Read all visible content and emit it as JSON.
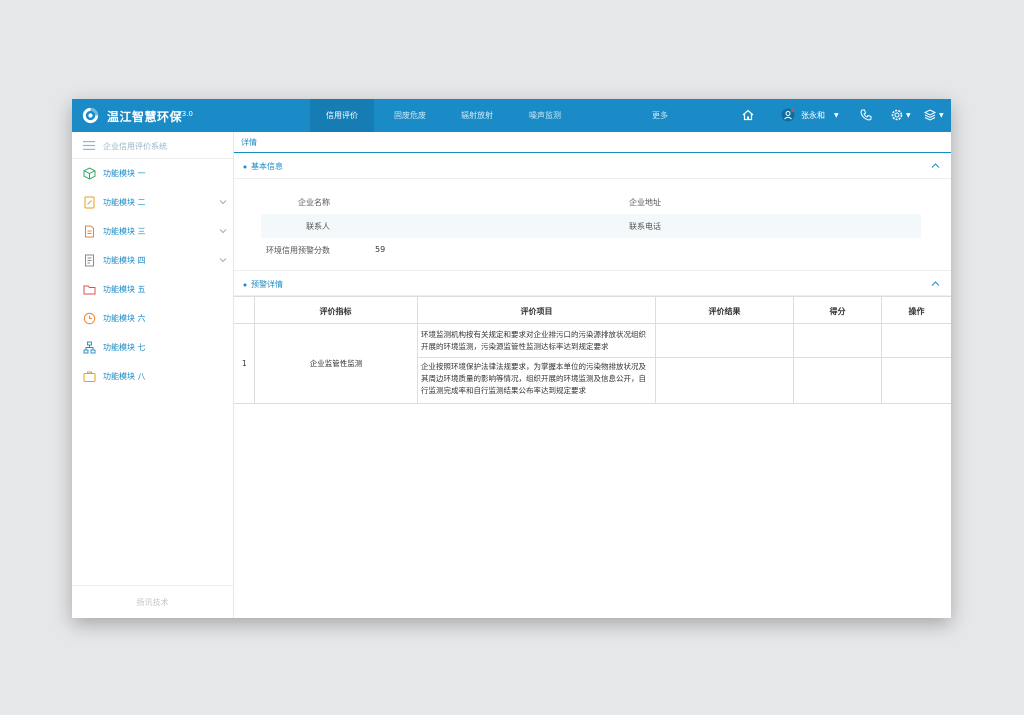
{
  "header": {
    "app_title": "温江智慧环保",
    "version": "V3.0",
    "nav_tabs": [
      {
        "label": "信用评价",
        "active": true
      },
      {
        "label": "固废危废",
        "active": false
      },
      {
        "label": "辐射放射",
        "active": false
      },
      {
        "label": "噪声监测",
        "active": false
      },
      {
        "label": "更多",
        "active": false
      }
    ],
    "user_name": "张永和",
    "icons": [
      "home-icon",
      "user-icon",
      "phone-icon",
      "settings-icon",
      "layers-icon"
    ]
  },
  "sidebar": {
    "header_label": "企业信用评价系统",
    "items": [
      {
        "label": "功能模块 一",
        "icon": "cube-icon",
        "color": "#3aa56a",
        "expandable": false
      },
      {
        "label": "功能模块 二",
        "icon": "document-edit-icon",
        "color": "#e6a21a",
        "expandable": true
      },
      {
        "label": "功能模块 三",
        "icon": "document-icon",
        "color": "#e8862e",
        "expandable": true
      },
      {
        "label": "功能模块 四",
        "icon": "document-list-icon",
        "color": "#8a8a8a",
        "expandable": true
      },
      {
        "label": "功能模块 五",
        "icon": "folder-icon",
        "color": "#d9534f",
        "expandable": false
      },
      {
        "label": "功能模块 六",
        "icon": "clock-icon",
        "color": "#e8862e",
        "expandable": false
      },
      {
        "label": "功能模块 七",
        "icon": "org-chart-icon",
        "color": "#1a8bc6",
        "expandable": false
      },
      {
        "label": "功能模块 八",
        "icon": "briefcase-icon",
        "color": "#e6a21a",
        "expandable": false
      }
    ],
    "footer": "扬讯技术"
  },
  "main": {
    "tab_label": "详情",
    "basic_info": {
      "title": "基本信息",
      "fields": {
        "company_name_label": "企业名称",
        "company_name_value": "",
        "company_address_label": "企业地址",
        "company_address_value": "",
        "contact_label": "联系人",
        "contact_value": "",
        "phone_label": "联系电话",
        "phone_value": "",
        "score_label": "环境信用预警分数",
        "score_value": "59"
      }
    },
    "warning": {
      "title": "预警详情",
      "columns": [
        "评价指标",
        "评价项目",
        "评价结果",
        "得分",
        "操作"
      ],
      "rows": [
        {
          "index": "1",
          "indicator": "企业监管性监测",
          "items": [
            {
              "text": "环境监测机构按有关规定和要求对企业排污口的污染源排放状况组织开展的环境监测，污染源监管性监测达标率达到规定要求",
              "result": "",
              "score": "",
              "action": ""
            },
            {
              "text": "企业按照环境保护法律法规要求，为掌握本单位的污染物排放状况及其周边环境质量的影响等情况，组织开展的环境监测及信息公开，自行监测完成率和自行监测结果公布率达到规定要求",
              "result": "",
              "score": "",
              "action": ""
            }
          ]
        }
      ]
    }
  },
  "colors": {
    "primary": "#1a8bc6",
    "active_tab": "#157db3",
    "row_shade": "#f3f8fb"
  }
}
